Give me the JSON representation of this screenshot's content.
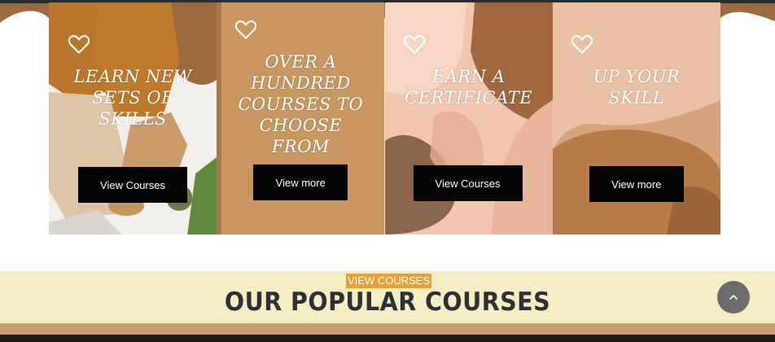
{
  "colors": {
    "accent": "#e8a037",
    "button_bg": "#050505",
    "section_bg": "#f5eec3",
    "card2_bg": "#c8965f",
    "card3_bg": "#f0c6ad",
    "card4_bg": "#d6a47c"
  },
  "cards": [
    {
      "title": "Learn new sets of skills",
      "button": "View Courses",
      "icon": "heart-icon"
    },
    {
      "title": "Over a hundred courses to choose from",
      "button": "View more",
      "icon": "heart-icon"
    },
    {
      "title": "Earn a certificate",
      "button": "View Courses",
      "icon": "heart-icon"
    },
    {
      "title": "Up your skill",
      "button": "View more",
      "icon": "heart-icon"
    }
  ],
  "section": {
    "tag": "VIEW COURSES",
    "title": "OUR POPULAR COURSES"
  },
  "scroll_top": {
    "icon": "chevron-up-icon"
  }
}
